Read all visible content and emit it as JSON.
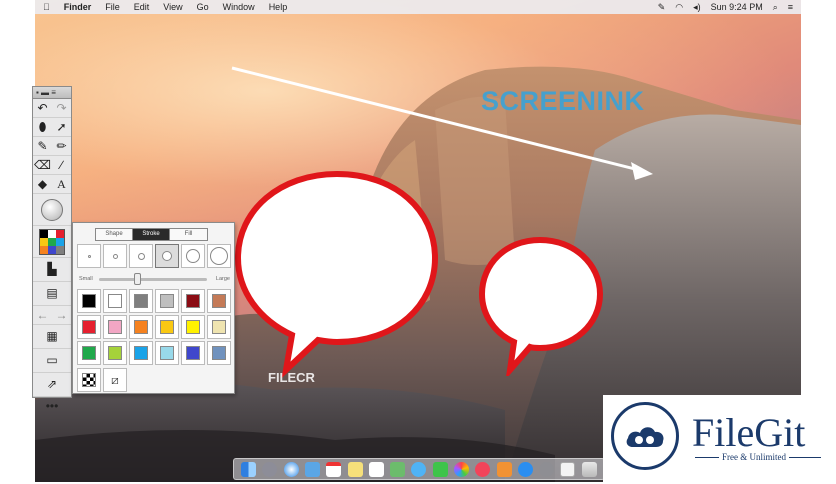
{
  "menubar": {
    "apple": "",
    "items": [
      "Finder",
      "File",
      "Edit",
      "View",
      "Go",
      "Window",
      "Help"
    ],
    "clock": "Sun 9:24 PM"
  },
  "canvas": {
    "annotation_text": "SCREENINK",
    "watermark": "FILECR"
  },
  "toolbar": {
    "title_controls": "▪ ▬ ≡",
    "rows": [
      [
        "↶",
        "↷"
      ],
      [
        "⬮",
        "➚"
      ],
      [
        "✎",
        "✏"
      ],
      [
        "⌫",
        "∕"
      ],
      [
        "◆",
        "A"
      ]
    ],
    "more": "•••"
  },
  "panel": {
    "tabs": [
      "Shape",
      "Stroke",
      "Fill"
    ],
    "active_tab": "Stroke",
    "slider_small": "Small",
    "slider_large": "Large",
    "slider_value": 0.35,
    "colors": [
      "#000000",
      "#ffffff",
      "#7f7f7f",
      "#bfbfbf",
      "#8b0c14",
      "#c47a57",
      "#e5202f",
      "#f2a6c4",
      "#f58220",
      "#f9c813",
      "#fff200",
      "#efe4b0",
      "#20a84b",
      "#a5d23a",
      "#1aa3e8",
      "#98d9ea",
      "#3f47cc",
      "#7092be"
    ]
  },
  "dock": {
    "icons": [
      "finder",
      "launchpad",
      "safari",
      "mail",
      "calendar",
      "notes",
      "reminders",
      "maps",
      "messages",
      "facetime",
      "photos",
      "music",
      "books",
      "app-store",
      "preferences",
      "document",
      "trash"
    ]
  },
  "badge": {
    "name": "FileGit",
    "tagline": "Free & Unlimited"
  },
  "colors": {
    "bubble_stroke": "#e0161a",
    "arrow": "#ffffff",
    "annotation": "#3aa3d8",
    "brand": "#1b3a6b"
  }
}
